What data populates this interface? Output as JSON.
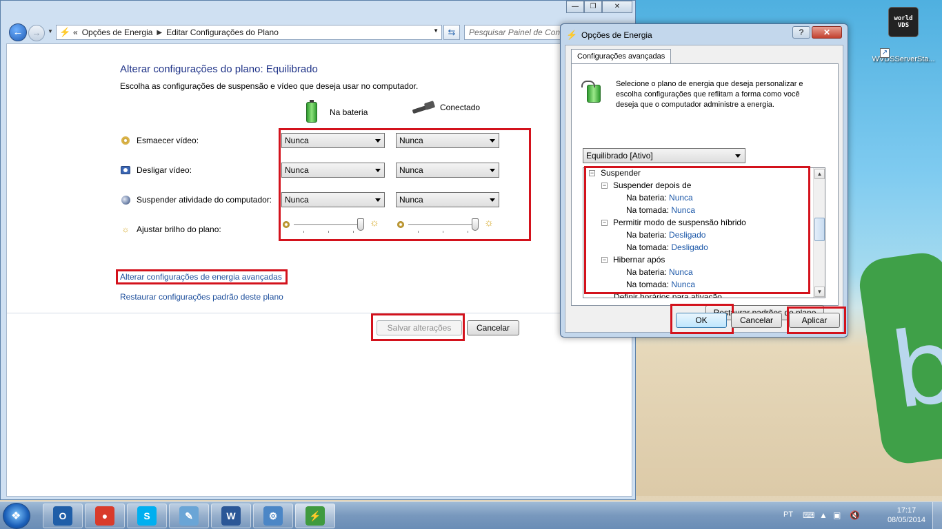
{
  "desktop": {
    "icon_label": "WVDSServerSta...",
    "icon_badge": "world VDS"
  },
  "explorer": {
    "address": {
      "crumb_root_marker": "«",
      "crumb1": "Opções de Energia",
      "crumb2": "Editar Configurações do Plano"
    },
    "search_placeholder": "Pesquisar Painel de Controle",
    "page_title": "Alterar configurações do plano: Equilibrado",
    "page_subtitle": "Escolha as configurações de suspensão e vídeo que deseja usar no computador.",
    "col_battery": "Na bateria",
    "col_plugged": "Conectado",
    "settings": [
      {
        "label": "Esmaecer vídeo:",
        "battery": "Nunca",
        "plugged": "Nunca",
        "icon": "dim-display-icon"
      },
      {
        "label": "Desligar vídeo:",
        "battery": "Nunca",
        "plugged": "Nunca",
        "icon": "display-off-icon"
      },
      {
        "label": "Suspender atividade do computador:",
        "battery": "Nunca",
        "plugged": "Nunca",
        "icon": "sleep-moon-icon"
      }
    ],
    "brightness_label": "Ajustar brilho do plano:",
    "brightness_battery_level": 1.0,
    "brightness_plugged_level": 1.0,
    "link_advanced": "Alterar configurações de energia avançadas",
    "link_restore": "Restaurar configurações padrão deste plano",
    "save_label": "Salvar alterações",
    "cancel_label": "Cancelar"
  },
  "dialog": {
    "title": "Opções de Energia",
    "help": "?",
    "close": "✕",
    "tab": "Configurações avançadas",
    "description": "Selecione o plano de energia que deseja personalizar e escolha configurações que reflitam a forma como você deseja que o computador administre a energia.",
    "plan_selected": "Equilibrado [Ativo]",
    "tree": {
      "suspend": "Suspender",
      "suspend_after": "Suspender depois de",
      "suspend_after_battery_label": "Na bateria:",
      "suspend_after_battery_value": "Nunca",
      "suspend_after_plugged_label": "Na tomada:",
      "suspend_after_plugged_value": "Nunca",
      "hybrid": "Permitir modo de suspensão híbrido",
      "hybrid_battery_label": "Na bateria:",
      "hybrid_battery_value": "Desligado",
      "hybrid_plugged_label": "Na tomada:",
      "hybrid_plugged_value": "Desligado",
      "hibernate": "Hibernar após",
      "hibernate_battery_label": "Na bateria:",
      "hibernate_battery_value": "Nunca",
      "hibernate_plugged_label": "Na tomada:",
      "hibernate_plugged_value": "Nunca",
      "clipped": "Definir horários para ativação"
    },
    "restore_label": "Restaurar padrões do plano",
    "ok_label": "OK",
    "cancel_label": "Cancelar",
    "apply_label": "Aplicar"
  },
  "taskbar": {
    "apps": [
      {
        "name": "outlook",
        "glyph": "O",
        "color": "#1f5ea8"
      },
      {
        "name": "chrome",
        "glyph": "●",
        "color": "#d93b2b"
      },
      {
        "name": "skype",
        "glyph": "S",
        "color": "#00aff0"
      },
      {
        "name": "notepad",
        "glyph": "✎",
        "color": "#6aa5d6"
      },
      {
        "name": "word",
        "glyph": "W",
        "color": "#2b5797"
      },
      {
        "name": "control-panel",
        "glyph": "⚙",
        "color": "#4b86c6"
      },
      {
        "name": "power-options",
        "glyph": "⚡",
        "color": "#3f9a3f"
      }
    ],
    "language": "PT",
    "time": "17:17",
    "date": "08/05/2014"
  },
  "colors": {
    "highlight_red": "#d3121c",
    "link_blue": "#1e4f9c",
    "title_blue": "#1e3287"
  }
}
